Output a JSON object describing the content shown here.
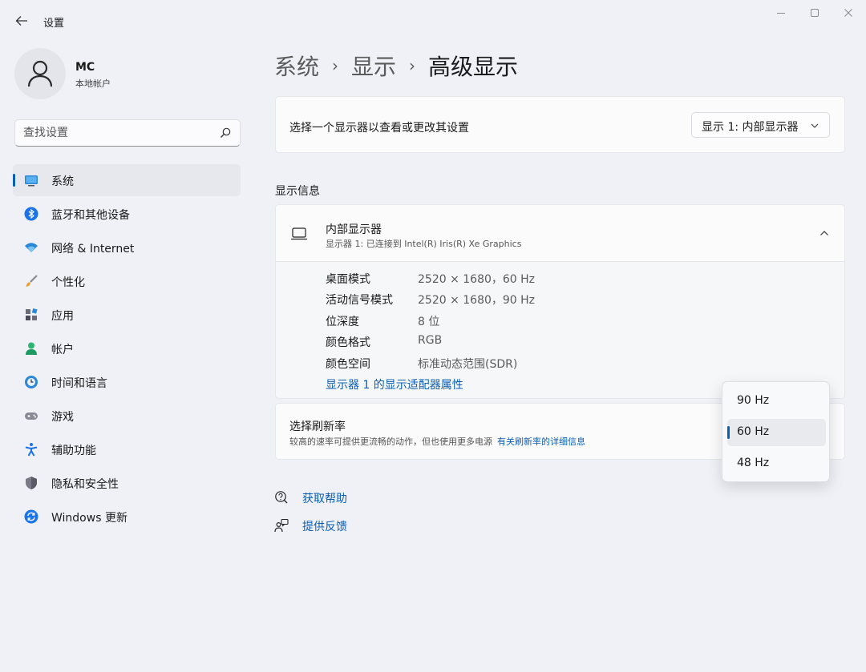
{
  "window": {
    "title": "设置",
    "back_icon": "arrow-left-icon",
    "controls": [
      "minimize-icon",
      "maximize-icon",
      "close-icon"
    ]
  },
  "profile": {
    "name": "MC",
    "account_type": "本地帐户"
  },
  "search": {
    "placeholder": "查找设置"
  },
  "sidebar": {
    "items": [
      {
        "label": "系统",
        "icon": "display-icon",
        "active": true
      },
      {
        "label": "蓝牙和其他设备",
        "icon": "bluetooth-icon"
      },
      {
        "label": "网络 & Internet",
        "icon": "wifi-icon"
      },
      {
        "label": "个性化",
        "icon": "brush-icon"
      },
      {
        "label": "应用",
        "icon": "apps-icon"
      },
      {
        "label": "帐户",
        "icon": "person-icon"
      },
      {
        "label": "时间和语言",
        "icon": "globe-clock-icon"
      },
      {
        "label": "游戏",
        "icon": "gamepad-icon"
      },
      {
        "label": "辅助功能",
        "icon": "accessibility-icon"
      },
      {
        "label": "隐私和安全性",
        "icon": "shield-icon"
      },
      {
        "label": "Windows 更新",
        "icon": "update-icon"
      }
    ]
  },
  "breadcrumb": [
    "系统",
    "显示",
    "高级显示"
  ],
  "display_select": {
    "label": "选择一个显示器以查看或更改其设置",
    "selected": "显示 1: 内部显示器"
  },
  "display_info": {
    "section_title": "显示信息",
    "title": "内部显示器",
    "subtitle": "显示器 1: 已连接到 Intel(R) Iris(R) Xe Graphics",
    "rows": [
      {
        "key": "桌面模式",
        "value": "2520 × 1680，60 Hz"
      },
      {
        "key": "活动信号模式",
        "value": "2520 × 1680，90 Hz"
      },
      {
        "key": "位深度",
        "value": "8 位"
      },
      {
        "key": "颜色格式",
        "value": "RGB"
      },
      {
        "key": "颜色空间",
        "value": "标准动态范围(SDR)"
      }
    ],
    "adapter_link": "显示器 1 的显示适配器属性"
  },
  "refresh_rate": {
    "title": "选择刷新率",
    "description": "较高的速率可提供更流畅的动作，但也使用更多电源",
    "link": "有关刷新率的详细信息",
    "options": [
      "90 Hz",
      "60 Hz",
      "48 Hz"
    ],
    "selected": "60 Hz"
  },
  "help_links": [
    {
      "label": "获取帮助",
      "icon": "help-icon"
    },
    {
      "label": "提供反馈",
      "icon": "feedback-icon"
    }
  ],
  "colors": {
    "accent": "#0a5fb4",
    "background": "#eff1f7",
    "card": "#fbfbfc"
  }
}
